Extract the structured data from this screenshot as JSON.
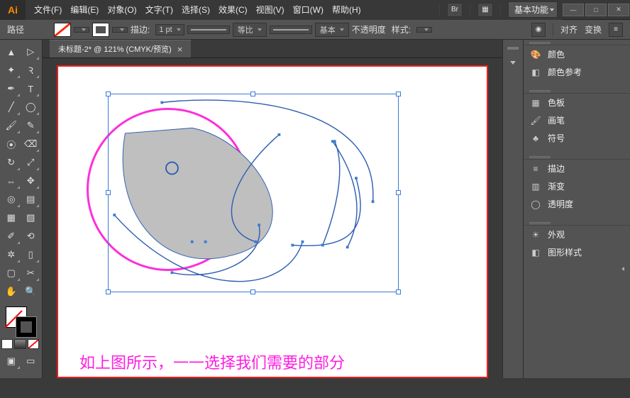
{
  "app": {
    "logo": "Ai"
  },
  "menu": {
    "file": "文件(F)",
    "edit": "编辑(E)",
    "object": "对象(O)",
    "type": "文字(T)",
    "select": "选择(S)",
    "effect": "效果(C)",
    "view": "视图(V)",
    "window": "窗口(W)",
    "help": "帮助(H)",
    "workspace": "基本功能"
  },
  "ctrl": {
    "selType": "路径",
    "strokeLabel": "描边:",
    "strokeWeight": "1 pt",
    "profile": "等比",
    "brush": "基本",
    "opacityLabel": "不透明度",
    "styleLabel": "样式:",
    "alignLabel": "对齐",
    "transformLabel": "变换"
  },
  "doc": {
    "tab": "未标题-2* @ 121% (CMYK/预览)"
  },
  "canvas": {
    "caption": "如上图所示，一一选择我们需要的部分"
  },
  "panels": {
    "color": "颜色",
    "colorGuide": "颜色参考",
    "swatches": "色板",
    "brushes": "画笔",
    "symbols": "符号",
    "stroke": "描边",
    "gradient": "渐变",
    "transparency": "透明度",
    "appearance": "外观",
    "graphicStyles": "图形样式"
  },
  "tools": {
    "selection": "selection",
    "directSelect": "direct-select",
    "magicWand": "magic-wand",
    "lasso": "lasso",
    "pen": "pen",
    "type": "type",
    "line": "line",
    "ellipse": "ellipse",
    "paintbrush": "paintbrush",
    "pencil": "pencil",
    "blob": "blob",
    "eraser": "eraser",
    "rotate": "rotate",
    "scale": "scale",
    "width": "width",
    "freeTransform": "free-transform",
    "shapeBuilder": "shape-builder",
    "perspective": "perspective",
    "mesh": "mesh",
    "gradient": "gradient",
    "eyedropper": "eyedropper",
    "blend": "blend",
    "symbolSprayer": "symbol-sprayer",
    "columnGraph": "column-graph",
    "artboard": "artboard",
    "slice": "slice",
    "hand": "hand",
    "zoom": "zoom"
  }
}
